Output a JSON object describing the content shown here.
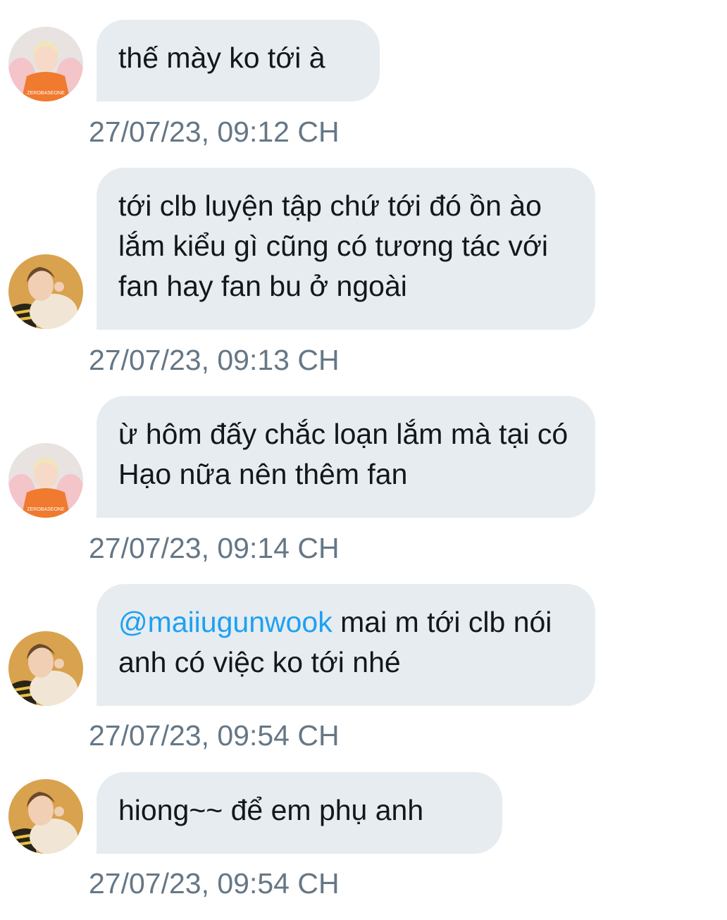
{
  "messages": [
    {
      "sender": "a",
      "text": "thế mày ko tới à",
      "timestamp": "27/07/23, 09:12 CH"
    },
    {
      "sender": "b",
      "text": "tới clb luyện tập chứ tới đó ồn ào lắm kiểu gì cũng có tương tác với fan hay fan bu ở ngoài",
      "timestamp": "27/07/23, 09:13 CH"
    },
    {
      "sender": "a",
      "text": "ừ hôm đấy chắc loạn lắm mà tại có Hạo nữa nên thêm fan",
      "timestamp": "27/07/23, 09:14 CH"
    },
    {
      "sender": "b",
      "mention": "@maiiugunwook",
      "text": " mai m tới clb nói anh có việc ko tới nhé",
      "timestamp": "27/07/23, 09:54 CH"
    },
    {
      "sender": "b",
      "text": "hiong~~ để em phụ anh",
      "timestamp": "27/07/23, 09:54 CH"
    }
  ],
  "colors": {
    "bubble": "#e6ecf0",
    "text": "#14171a",
    "timestamp": "#657786",
    "mention": "#1da1f2"
  },
  "avatar_a_shirt_text": "ZEROBASEONE"
}
